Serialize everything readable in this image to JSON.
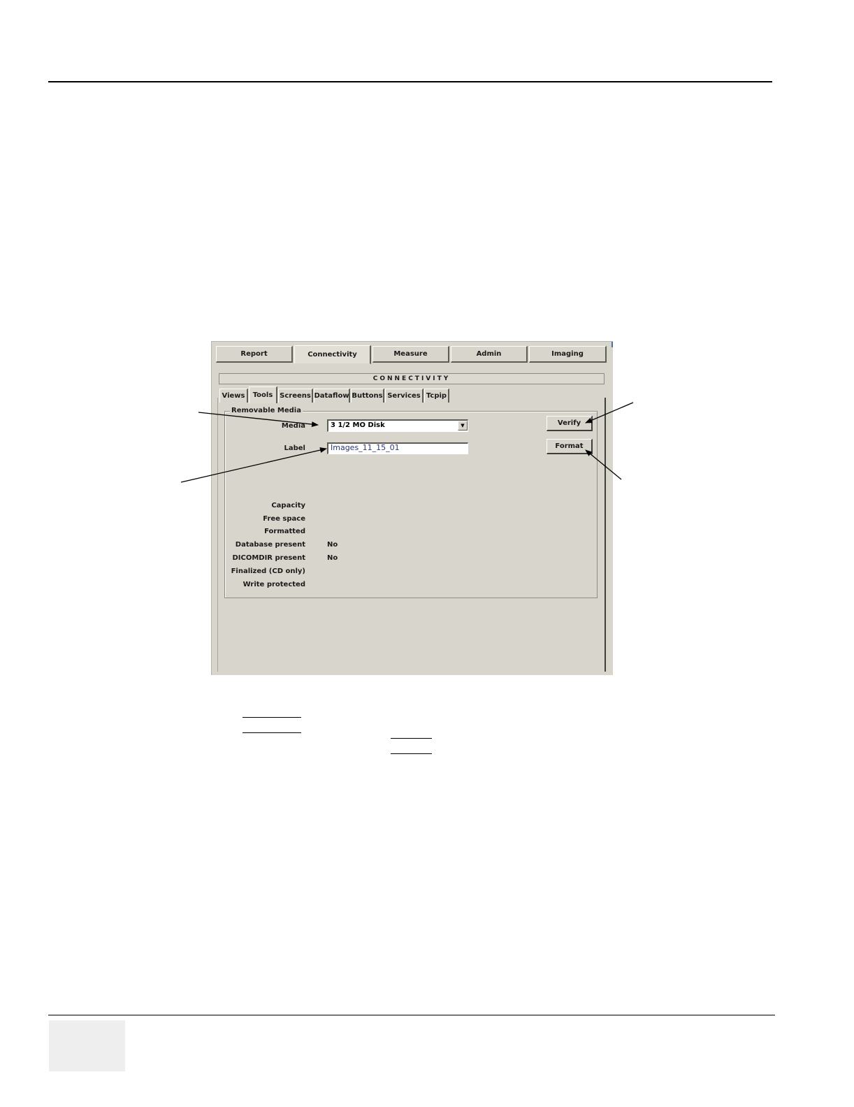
{
  "main_tabs": [
    {
      "label": "Report"
    },
    {
      "label": "Connectivity"
    },
    {
      "label": "Measure"
    },
    {
      "label": "Admin"
    },
    {
      "label": "Imaging"
    }
  ],
  "section_title": "CONNECTIVITY",
  "sub_tabs": [
    {
      "label": "Views"
    },
    {
      "label": "Tools"
    },
    {
      "label": "Screens"
    },
    {
      "label": "Dataflow"
    },
    {
      "label": "Buttons"
    },
    {
      "label": "Services"
    },
    {
      "label": "Tcpip"
    }
  ],
  "removable_media": {
    "group_title": "Removable Media",
    "media_label": "Media",
    "media_value": "3 1/2 MO Disk",
    "label_label": "Label",
    "label_value": "Images_11_15_01",
    "verify_button": "Verify",
    "format_button": "Format",
    "properties": [
      {
        "name": "Capacity",
        "value": ""
      },
      {
        "name": "Free space",
        "value": ""
      },
      {
        "name": "Formatted",
        "value": ""
      },
      {
        "name": "Database present",
        "value": "No"
      },
      {
        "name": "DICOMDIR present",
        "value": "No"
      },
      {
        "name": "Finalized (CD only)",
        "value": ""
      },
      {
        "name": "Write protected",
        "value": ""
      }
    ]
  }
}
